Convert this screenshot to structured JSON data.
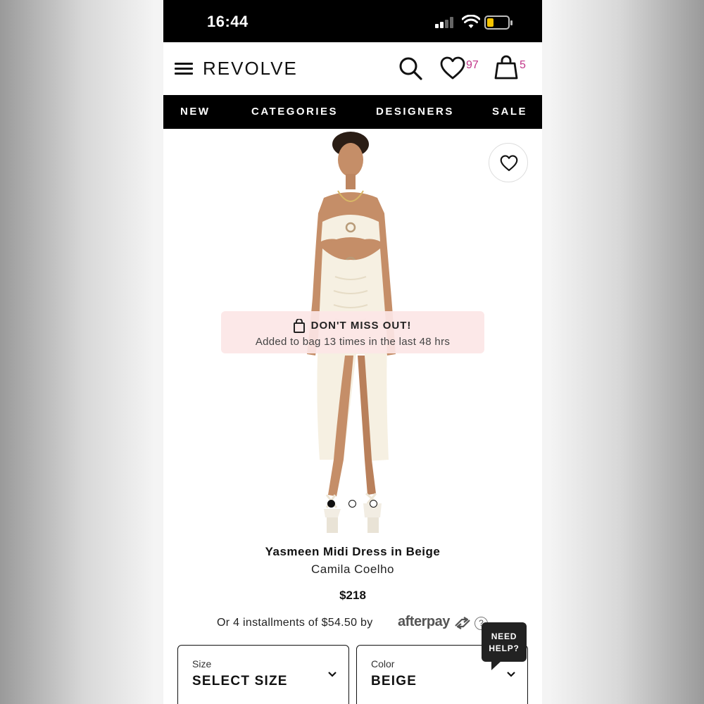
{
  "status_bar": {
    "time": "16:44",
    "battery_color": "#f5c400"
  },
  "header": {
    "logo": "REVOLVE",
    "wishlist_count": "97",
    "bag_count": "5",
    "accent_color": "#c2378a",
    "icons": [
      "menu-icon",
      "search-icon",
      "heart-icon",
      "bag-icon"
    ]
  },
  "nav": {
    "items": [
      {
        "label": "NEW"
      },
      {
        "label": "CATEGORIES"
      },
      {
        "label": "DESIGNERS"
      },
      {
        "label": "SALE"
      }
    ]
  },
  "gallery": {
    "image_count": 3,
    "active_index": 0
  },
  "promo": {
    "title": "DON'T MISS OUT!",
    "subtitle": "Added to bag 13 times in the last 48 hrs",
    "background_color": "#fce6e6"
  },
  "product": {
    "name": "Yasmeen Midi Dress in Beige",
    "brand": "Camila Coelho",
    "price": "$218",
    "installments_text": "Or 4 installments of $54.50 by",
    "afterpay_label": "afterpay",
    "help_symbol": "?"
  },
  "selectors": {
    "size": {
      "label": "Size",
      "value": "SELECT SIZE"
    },
    "color": {
      "label": "Color",
      "value": "BEIGE"
    }
  },
  "help": {
    "line1": "NEED",
    "line2": "HELP?"
  }
}
